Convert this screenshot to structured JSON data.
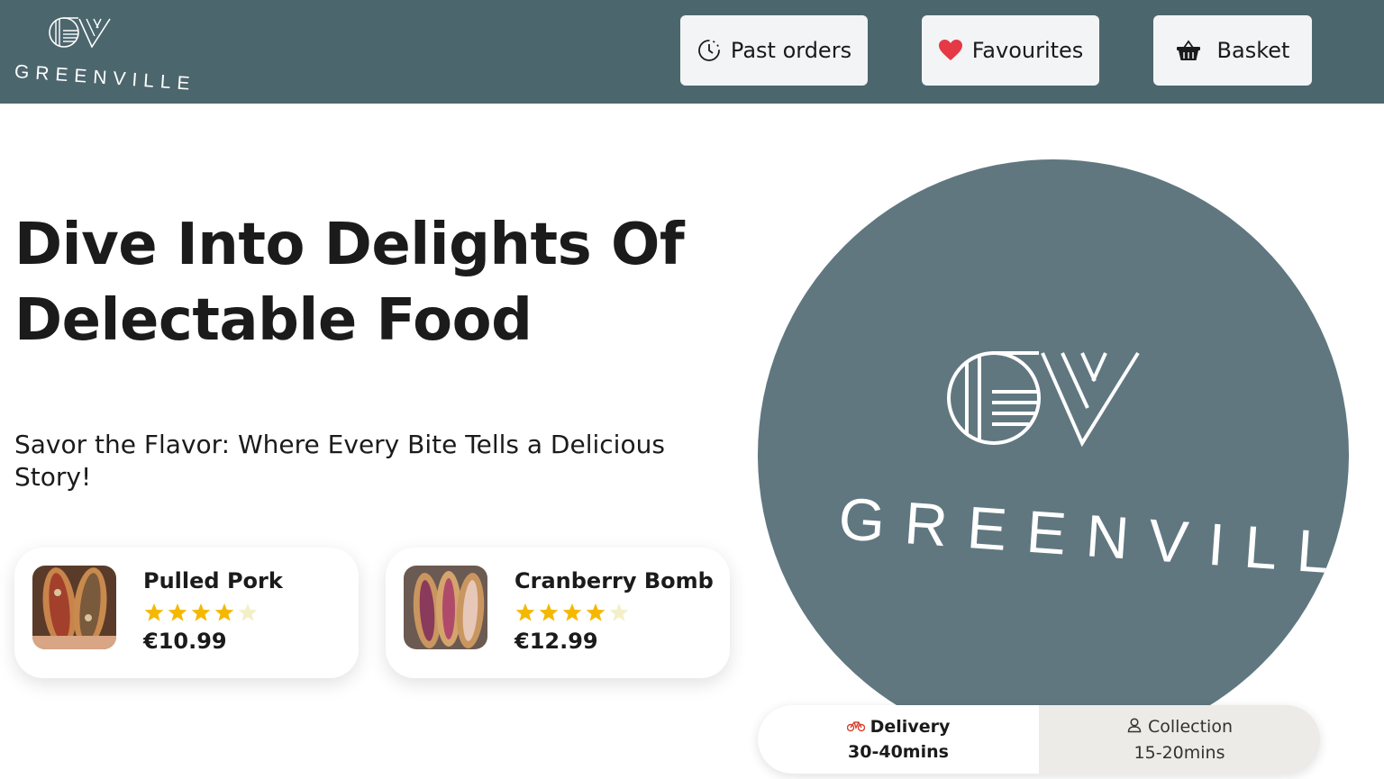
{
  "brand": {
    "name": "GREENVILLE",
    "monogram": "GV",
    "accent": "#4c666d",
    "circle_color": "#607780"
  },
  "header": {
    "buttons": [
      {
        "label": "Past orders",
        "icon": "clock-icon"
      },
      {
        "label": "Favourites",
        "icon": "heart-icon",
        "icon_color": "#e53946"
      },
      {
        "label": "Basket",
        "icon": "basket-icon"
      }
    ]
  },
  "hero": {
    "title": "Dive Into Delights Of Delectable Food",
    "subtitle": "Savor the Flavor: Where Every Bite Tells a Delicious Story!"
  },
  "featured": [
    {
      "name": "Pulled Pork",
      "rating": 4,
      "max_rating": 5,
      "price": "€10.99"
    },
    {
      "name": "Cranberry Bomb",
      "rating": 4,
      "max_rating": 5,
      "price": "€12.99"
    }
  ],
  "fulfilment": {
    "delivery": {
      "label": "Delivery",
      "time": "30-40mins",
      "icon": "bike-icon",
      "selected": true
    },
    "collection": {
      "label": "Collection",
      "time": "15-20mins",
      "icon": "person-icon",
      "selected": false
    }
  },
  "star_colors": {
    "filled": "#f5b800",
    "empty": "#f3f0c9"
  }
}
